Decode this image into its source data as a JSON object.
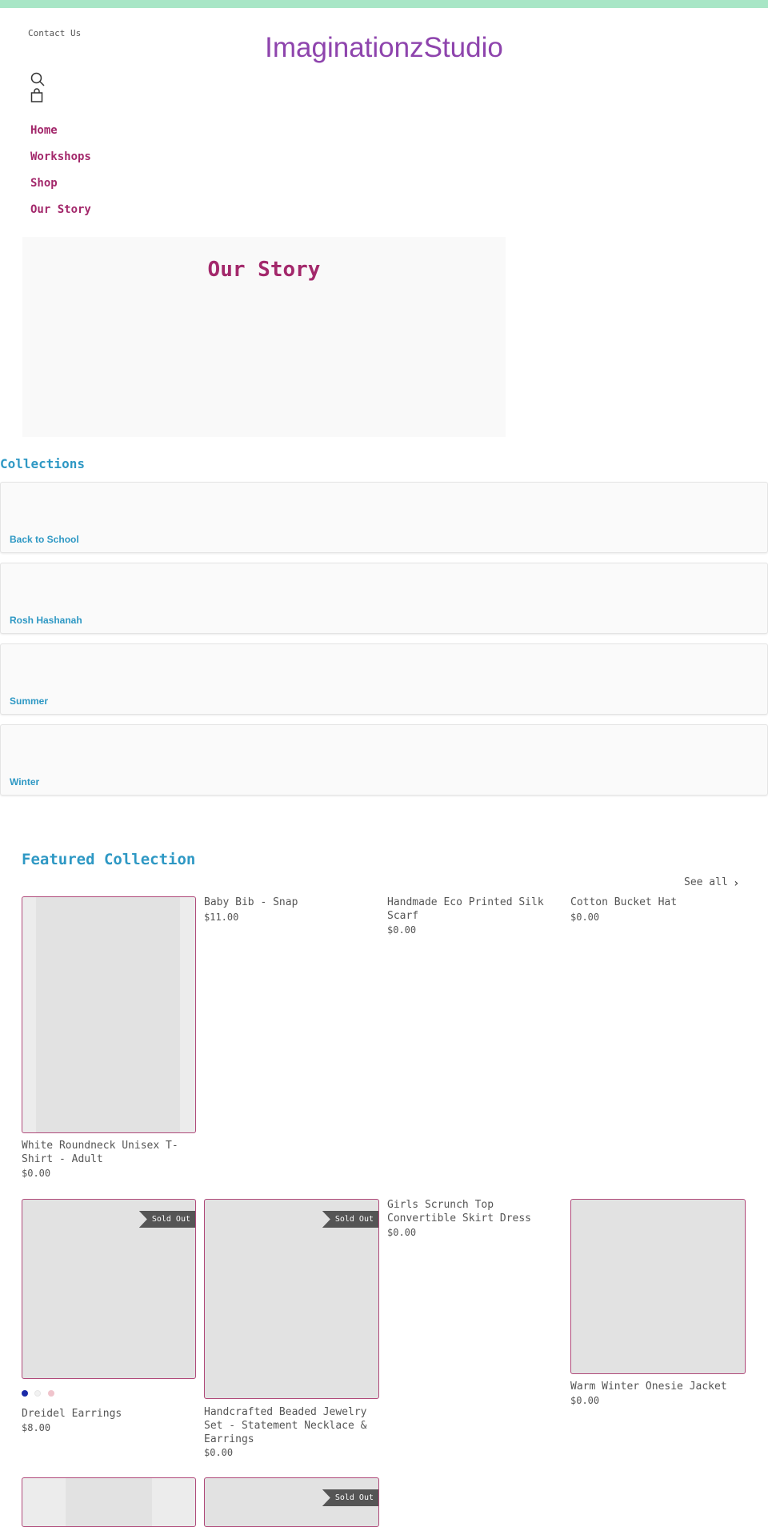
{
  "header": {
    "contact_link": "Contact Us",
    "logo": "ImaginationzStudio",
    "search_icon": "search-icon",
    "cart_icon": "shopping-bag-icon"
  },
  "nav": {
    "items": [
      "Home",
      "Workshops",
      "Shop",
      "Our Story"
    ]
  },
  "hero": {
    "title": "Our Story"
  },
  "collections": {
    "heading": "Collections",
    "items": [
      "Back to School",
      "Rosh Hashanah",
      "Summer",
      "Winter"
    ]
  },
  "featured": {
    "heading": "Featured Collection",
    "see_all": "See all",
    "sold_out": "Sold Out",
    "swatch_colors": [
      "#1a2aa8",
      "#f2f2f2",
      "#f0c4cc"
    ],
    "products": [
      {
        "title": "White Roundneck Unisex T-Shirt - Adult",
        "price": "$0.00"
      },
      {
        "title": "Baby Bib - Snap",
        "price": "$11.00"
      },
      {
        "title": "Handmade Eco Printed Silk Scarf",
        "price": "$0.00"
      },
      {
        "title": "Cotton Bucket Hat",
        "price": "$0.00"
      },
      {
        "title": "Dreidel Earrings",
        "price": "$8.00"
      },
      {
        "title": "Handcrafted Beaded Jewelry Set - Statement Necklace & Earrings",
        "price": "$0.00"
      },
      {
        "title": "Girls Scrunch Top Convertible Skirt Dress",
        "price": "$0.00"
      },
      {
        "title": "Warm Winter Onesie Jacket",
        "price": "$0.00"
      }
    ]
  }
}
